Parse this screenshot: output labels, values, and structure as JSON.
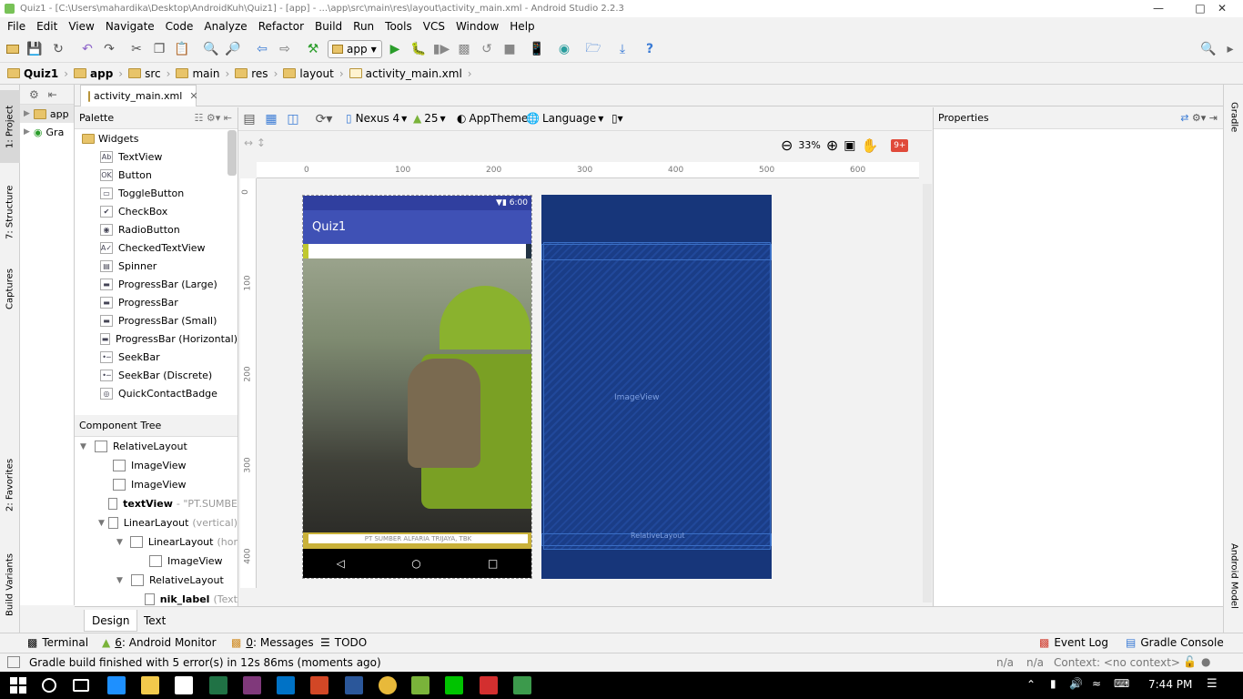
{
  "window": {
    "title": "Quiz1 - [C:\\Users\\mahardika\\Desktop\\AndroidKuh\\Quiz1] - [app] - ...\\app\\src\\main\\res\\layout\\activity_main.xml - Android Studio 2.2.3"
  },
  "menu": [
    "File",
    "Edit",
    "View",
    "Navigate",
    "Code",
    "Analyze",
    "Refactor",
    "Build",
    "Run",
    "Tools",
    "VCS",
    "Window",
    "Help"
  ],
  "toolbar": {
    "run_config": "app"
  },
  "breadcrumb": [
    "Quiz1",
    "app",
    "src",
    "main",
    "res",
    "layout",
    "activity_main.xml"
  ],
  "left_tabs": [
    "1: Project",
    "7: Structure",
    "Captures",
    "2: Favorites",
    "Build Variants"
  ],
  "right_tabs": [
    "Gradle",
    "Android Model"
  ],
  "project": {
    "items": [
      "app",
      "Gra"
    ]
  },
  "file_tab": "activity_main.xml",
  "palette": {
    "title": "Palette",
    "group": "Widgets",
    "items": [
      "TextView",
      "Button",
      "ToggleButton",
      "CheckBox",
      "RadioButton",
      "CheckedTextView",
      "Spinner",
      "ProgressBar (Large)",
      "ProgressBar",
      "ProgressBar (Small)",
      "ProgressBar (Horizontal)",
      "SeekBar",
      "SeekBar (Discrete)",
      "QuickContactBadge"
    ]
  },
  "component_tree": {
    "title": "Component Tree",
    "nodes": [
      {
        "label": "RelativeLayout",
        "extra": ""
      },
      {
        "label": "ImageView",
        "extra": ""
      },
      {
        "label": "ImageView",
        "extra": ""
      },
      {
        "label": "textView",
        "extra": "- \"PT.SUMBE"
      },
      {
        "label": "LinearLayout",
        "extra": "(vertical)"
      },
      {
        "label": "LinearLayout",
        "extra": "(hor"
      },
      {
        "label": "ImageView",
        "extra": ""
      },
      {
        "label": "RelativeLayout",
        "extra": ""
      },
      {
        "label": "nik_label",
        "extra": "(Text"
      }
    ]
  },
  "design_toolbar": {
    "device": "Nexus 4",
    "api": "25",
    "theme": "AppTheme",
    "language": "Language"
  },
  "zoom": {
    "level": "33%",
    "badge": "9+"
  },
  "ruler": {
    "h": [
      "0",
      "100",
      "200",
      "300",
      "400",
      "500",
      "600"
    ],
    "v": [
      "0",
      "100",
      "200",
      "300",
      "400"
    ]
  },
  "phone": {
    "time": "6:00",
    "app_title": "Quiz1",
    "footer_text": "PT SUMBER ALFARIA TRIJAYA, TBK"
  },
  "blueprint": {
    "center_label": "ImageView",
    "bottom_label": "RelativeLayout"
  },
  "properties": {
    "title": "Properties"
  },
  "editor_tabs": [
    "Design",
    "Text"
  ],
  "tool_windows": {
    "left": [
      {
        "num": "",
        "label": "Terminal"
      },
      {
        "num": "6",
        "label": ": Android Monitor"
      },
      {
        "num": "0",
        "label": ": Messages"
      },
      {
        "num": "",
        "label": "TODO"
      }
    ],
    "right": [
      "Event Log",
      "Gradle Console"
    ]
  },
  "status": {
    "message": "Gradle build finished with 5 error(s) in 12s 86ms (moments ago)",
    "na1": "n/a",
    "na2": "n/a",
    "context": "Context: <no context>"
  },
  "taskbar": {
    "time": "7:44 PM"
  }
}
